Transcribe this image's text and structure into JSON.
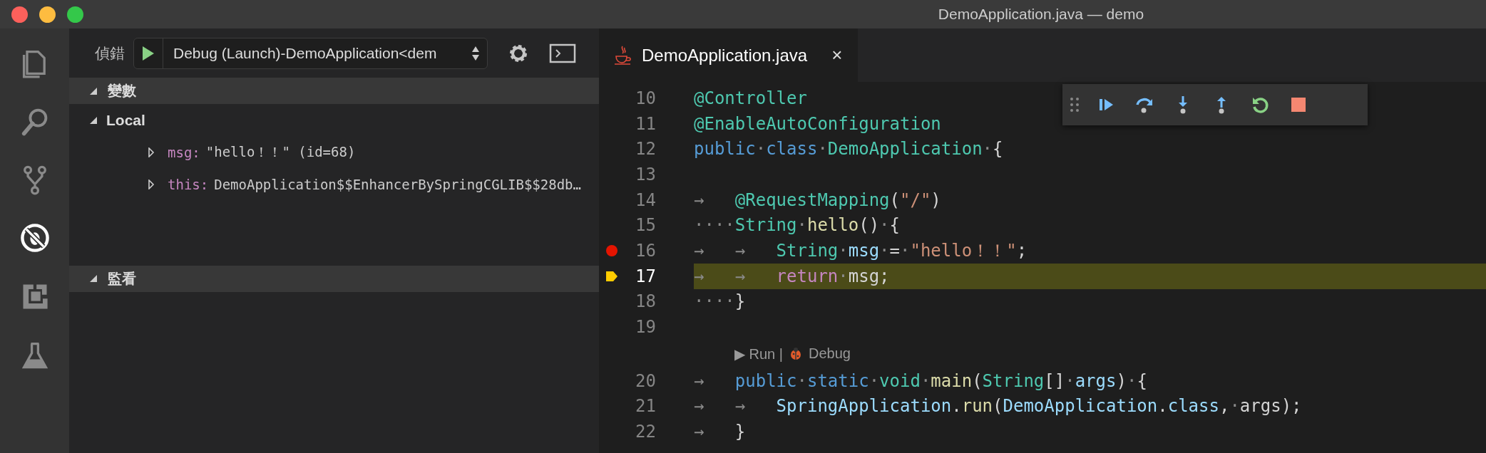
{
  "window": {
    "title": "DemoApplication.java — demo"
  },
  "activity_bar": {
    "items": [
      {
        "kind": "files",
        "selected": false
      },
      {
        "kind": "search",
        "selected": false
      },
      {
        "kind": "scm",
        "selected": false
      },
      {
        "kind": "debug",
        "selected": true
      },
      {
        "kind": "extensions",
        "selected": false
      },
      {
        "kind": "test",
        "selected": false
      }
    ]
  },
  "debug_toolbar": {
    "label": "偵錯",
    "configuration": "Debug (Launch)-DemoApplication<dem"
  },
  "sections": [
    {
      "title": "變數",
      "expanded": true,
      "items": [
        {
          "label": "Local",
          "expanded": true,
          "children": [
            {
              "name": "msg:",
              "value": "\"hello！！\" (id=68)",
              "expanded": false
            },
            {
              "name": "this:",
              "value": "DemoApplication$$EnhancerBySpringCGLIB$$28db…",
              "expanded": false
            }
          ]
        }
      ]
    },
    {
      "title": "監看",
      "expanded": true
    }
  ],
  "editor": {
    "tabs": [
      {
        "label": "DemoApplication.java",
        "close": "×",
        "selected": true
      }
    ],
    "lines": [
      {
        "number": "10",
        "tokens": [
          {
            "text": "@Controller",
            "kind": "annot"
          }
        ]
      },
      {
        "number": "11",
        "tokens": [
          {
            "text": "@EnableAutoConfiguration",
            "kind": "annot"
          }
        ]
      },
      {
        "number": "12",
        "tokens": [
          {
            "text": "public",
            "kind": "kw"
          },
          {
            "text": "·",
            "kind": "sp"
          },
          {
            "text": "class",
            "kind": "kw"
          },
          {
            "text": "·",
            "kind": "sp"
          },
          {
            "text": "DemoApplication",
            "kind": "type"
          },
          {
            "text": "·",
            "kind": "sp"
          },
          {
            "text": "{",
            "kind": "punct"
          }
        ]
      },
      {
        "number": "13"
      },
      {
        "number": "14",
        "tokens": [
          {
            "text": "→",
            "kind": "tab"
          },
          {
            "text": "@RequestMapping",
            "kind": "annot"
          },
          {
            "text": "(",
            "kind": "punct"
          },
          {
            "text": "\"/\"",
            "kind": "str"
          },
          {
            "text": ")",
            "kind": "punct"
          }
        ]
      },
      {
        "number": "15",
        "tokens": [
          {
            "text": "····",
            "kind": "sp"
          },
          {
            "text": "String",
            "kind": "type"
          },
          {
            "text": "·",
            "kind": "sp"
          },
          {
            "text": "hello",
            "kind": "func"
          },
          {
            "text": "()",
            "kind": "punct"
          },
          {
            "text": "·",
            "kind": "sp"
          },
          {
            "text": "{",
            "kind": "punct"
          }
        ]
      },
      {
        "number": "16",
        "breakpoint": true,
        "tokens": [
          {
            "text": "→",
            "kind": "tab"
          },
          {
            "text": "→",
            "kind": "tab"
          },
          {
            "text": "String",
            "kind": "type"
          },
          {
            "text": "·",
            "kind": "sp"
          },
          {
            "text": "msg",
            "kind": "var"
          },
          {
            "text": "·",
            "kind": "sp"
          },
          {
            "text": "=",
            "kind": "punct"
          },
          {
            "text": "·",
            "kind": "sp"
          },
          {
            "text": "\"hello！！\"",
            "kind": "str"
          },
          {
            "text": ";",
            "kind": "punct"
          }
        ]
      },
      {
        "number": "17",
        "current": true,
        "tokens": [
          {
            "text": "→",
            "kind": "tab"
          },
          {
            "text": "→",
            "kind": "tab"
          },
          {
            "text": "return",
            "kind": "ctrl"
          },
          {
            "text": "·",
            "kind": "sp"
          },
          {
            "text": "msg",
            "kind": "punct"
          },
          {
            "text": ";",
            "kind": "punct"
          }
        ]
      },
      {
        "number": "18",
        "tokens": [
          {
            "text": "····",
            "kind": "sp"
          },
          {
            "text": "}",
            "kind": "punct"
          }
        ]
      },
      {
        "number": "19"
      },
      {
        "number": "20",
        "lens": {
          "run": "▶ Run |",
          "debug": "Debug"
        },
        "tokens": [
          {
            "text": "→",
            "kind": "tab"
          },
          {
            "text": "public",
            "kind": "kw"
          },
          {
            "text": "·",
            "kind": "sp"
          },
          {
            "text": "static",
            "kind": "kw"
          },
          {
            "text": "·",
            "kind": "sp"
          },
          {
            "text": "void",
            "kind": "type"
          },
          {
            "text": "·",
            "kind": "sp"
          },
          {
            "text": "main",
            "kind": "func"
          },
          {
            "text": "(",
            "kind": "punct"
          },
          {
            "text": "String",
            "kind": "type"
          },
          {
            "text": "[]",
            "kind": "punct"
          },
          {
            "text": "·",
            "kind": "sp"
          },
          {
            "text": "args",
            "kind": "var"
          },
          {
            "text": ")",
            "kind": "punct"
          },
          {
            "text": "·",
            "kind": "sp"
          },
          {
            "text": "{",
            "kind": "punct"
          }
        ]
      },
      {
        "number": "21",
        "tokens": [
          {
            "text": "→",
            "kind": "tab"
          },
          {
            "text": "→",
            "kind": "tab"
          },
          {
            "text": "SpringApplication",
            "kind": "var"
          },
          {
            "text": ".",
            "kind": "punct"
          },
          {
            "text": "run",
            "kind": "func"
          },
          {
            "text": "(",
            "kind": "punct"
          },
          {
            "text": "DemoApplication",
            "kind": "var"
          },
          {
            "text": ".",
            "kind": "punct"
          },
          {
            "text": "class",
            "kind": "var"
          },
          {
            "text": ",",
            "kind": "punct"
          },
          {
            "text": "·",
            "kind": "sp"
          },
          {
            "text": "args",
            "kind": "punct"
          },
          {
            "text": ");",
            "kind": "punct"
          }
        ]
      },
      {
        "number": "22",
        "tokens": [
          {
            "text": "→",
            "kind": "tab"
          },
          {
            "text": "}",
            "kind": "punct"
          }
        ]
      }
    ]
  }
}
